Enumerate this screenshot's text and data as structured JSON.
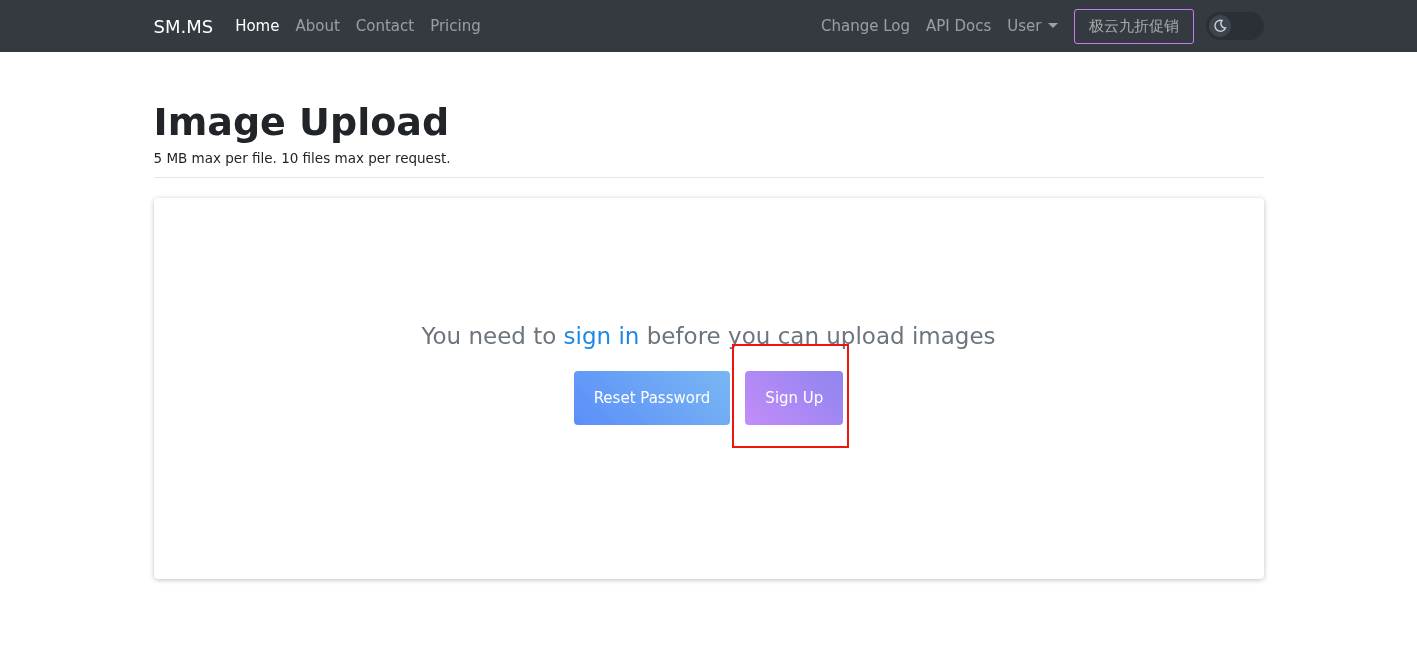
{
  "navbar": {
    "brand": "SM.MS",
    "links": [
      {
        "label": "Home",
        "selected": true
      },
      {
        "label": "About",
        "selected": false
      },
      {
        "label": "Contact",
        "selected": false
      },
      {
        "label": "Pricing",
        "selected": false
      }
    ],
    "right_links": [
      "Change Log",
      "API Docs"
    ],
    "user_menu": "User",
    "promo_button": "极云九折促销",
    "theme_toggle": {
      "on": false
    }
  },
  "header": {
    "title": "Image Upload",
    "subtitle": "5 MB max per file. 10 files max per request."
  },
  "notice": {
    "before": "You need to",
    "link": "sign in",
    "after": "before you can upload images"
  },
  "buttons": [
    {
      "label": "Reset Password",
      "kind": "blue",
      "highlighted": false
    },
    {
      "label": "Sign Up",
      "kind": "purple",
      "highlighted": true
    }
  ]
}
